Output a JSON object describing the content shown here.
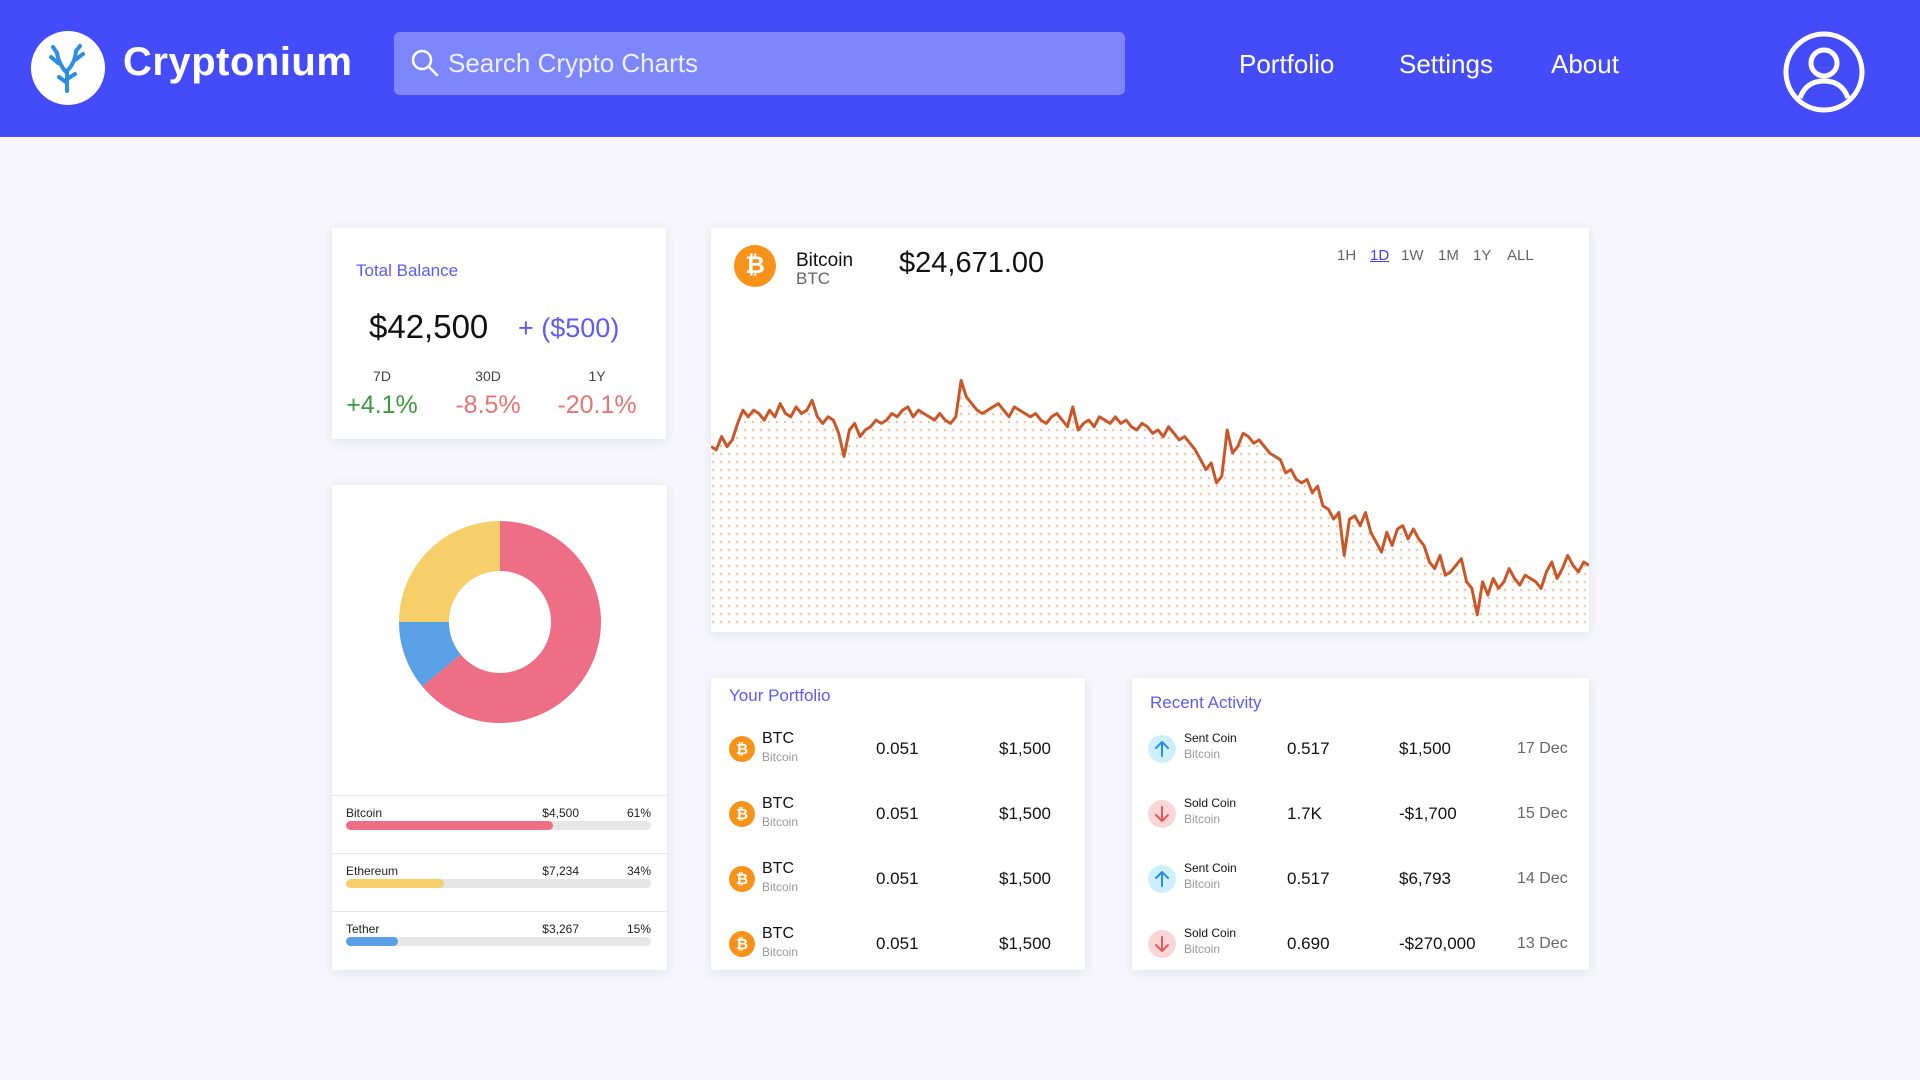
{
  "app": {
    "brand": "Cryptonium"
  },
  "search": {
    "placeholder": "Search Crypto Charts"
  },
  "nav": {
    "portfolio": "Portfolio",
    "settings": "Settings",
    "about": "About"
  },
  "colors": {
    "primary": "#444cfa",
    "accent_text": "#5c5cf0",
    "positive": "#3f9a3f",
    "negative": "#e77474",
    "bitcoin": "#f7931a",
    "chart_line": "#c8582a"
  },
  "balance": {
    "title": "Total Balance",
    "amount": "$42,500",
    "delta": "+ ($500)",
    "periods": [
      {
        "label": "7D",
        "change": "+4.1%",
        "trend": "up"
      },
      {
        "label": "30D",
        "change": "-8.5%",
        "trend": "down"
      },
      {
        "label": "1Y",
        "change": "-20.1%",
        "trend": "down"
      }
    ]
  },
  "allocation": {
    "items": [
      {
        "name": "Bitcoin",
        "value": "$4,500",
        "percent": "61%",
        "fraction": 0.68,
        "color": "#ee6e85"
      },
      {
        "name": "Ethereum",
        "value": "$7,234",
        "percent": "34%",
        "fraction": 0.32,
        "color": "#f7cf6a"
      },
      {
        "name": "Tether",
        "value": "$3,267",
        "percent": "15%",
        "fraction": 0.17,
        "color": "#5aa0e6"
      }
    ],
    "donut": [
      {
        "name": "Bitcoin",
        "fraction": 0.64,
        "color": "#ee6e85"
      },
      {
        "name": "Tether",
        "fraction": 0.11,
        "color": "#5aa0e6"
      },
      {
        "name": "Ethereum",
        "fraction": 0.25,
        "color": "#f7cf6a"
      }
    ]
  },
  "price_chart": {
    "coin_name": "Bitcoin",
    "coin_symbol": "BTC",
    "price": "$24,671.00",
    "timeframes": [
      "1H",
      "1D",
      "1W",
      "1M",
      "1Y",
      "ALL"
    ],
    "active_timeframe": "1D"
  },
  "chart_data": {
    "type": "area",
    "title": "",
    "xlabel": "",
    "ylabel": "",
    "ylim": [
      0,
      100
    ],
    "values": [
      55,
      54,
      58,
      55,
      57,
      62,
      66,
      64,
      66,
      65,
      63,
      66,
      64,
      68,
      65,
      64,
      67,
      65,
      66,
      69,
      64,
      62,
      64,
      63,
      59,
      52,
      60,
      62,
      58,
      60,
      61,
      63,
      62,
      63,
      65,
      64,
      66,
      67,
      64,
      66,
      65,
      64,
      63,
      65,
      63,
      62,
      64,
      75,
      70,
      68,
      66,
      65,
      66,
      67,
      68,
      66,
      64,
      67,
      66,
      65,
      64,
      65,
      63,
      62,
      64,
      65,
      63,
      61,
      67,
      60,
      62,
      63,
      61,
      64,
      63,
      62,
      64,
      62,
      63,
      61,
      60,
      62,
      61,
      59,
      60,
      58,
      61,
      59,
      57,
      58,
      56,
      54,
      51,
      48,
      50,
      44,
      46,
      60,
      53,
      55,
      59,
      58,
      56,
      57,
      55,
      53,
      52,
      51,
      47,
      48,
      45,
      44,
      45,
      41,
      43,
      37,
      36,
      33,
      35,
      22,
      33,
      34,
      31,
      35,
      29,
      26,
      23,
      29,
      25,
      30,
      31,
      27,
      30,
      27,
      25,
      20,
      18,
      22,
      16,
      17,
      19,
      21,
      14,
      12,
      4,
      14,
      10,
      15,
      12,
      14,
      18,
      15,
      13,
      16,
      15,
      14,
      12,
      17,
      20,
      15,
      18,
      22,
      19,
      17,
      20,
      19
    ]
  },
  "portfolio": {
    "title": "Your Portfolio",
    "rows": [
      {
        "symbol": "BTC",
        "name": "Bitcoin",
        "amount": "0.051",
        "value": "$1,500"
      },
      {
        "symbol": "BTC",
        "name": "Bitcoin",
        "amount": "0.051",
        "value": "$1,500"
      },
      {
        "symbol": "BTC",
        "name": "Bitcoin",
        "amount": "0.051",
        "value": "$1,500"
      },
      {
        "symbol": "BTC",
        "name": "Bitcoin",
        "amount": "0.051",
        "value": "$1,500"
      }
    ]
  },
  "activity": {
    "title": "Recent Activity",
    "rows": [
      {
        "type": "Sent Coin",
        "coin": "Bitcoin",
        "amount": "0.517",
        "value": "$1,500",
        "date": "17 Dec",
        "direction": "up"
      },
      {
        "type": "Sold Coin",
        "coin": "Bitcoin",
        "amount": "1.7K",
        "value": "-$1,700",
        "date": "15 Dec",
        "direction": "down"
      },
      {
        "type": "Sent Coin",
        "coin": "Bitcoin",
        "amount": "0.517",
        "value": "$6,793",
        "date": "14 Dec",
        "direction": "up"
      },
      {
        "type": "Sold Coin",
        "coin": "Bitcoin",
        "amount": "0.690",
        "value": "-$270,000",
        "date": "13 Dec",
        "direction": "down"
      }
    ]
  }
}
